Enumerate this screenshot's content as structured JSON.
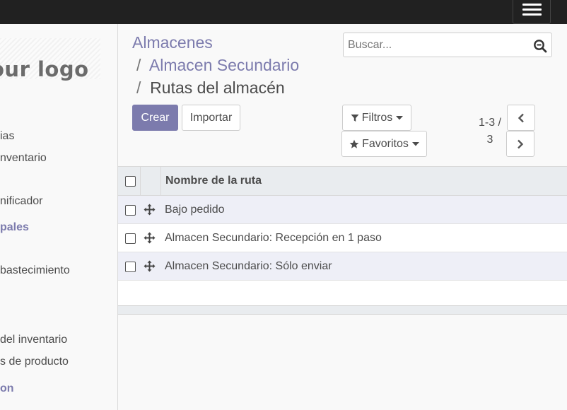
{
  "sidebar": {
    "logo_text": "our logo",
    "items": [
      {
        "label": "ias"
      },
      {
        "label": "nventario"
      },
      {
        "label": "nificador"
      },
      {
        "label": "pales"
      },
      {
        "label": "bastecimiento"
      },
      {
        "label": "del inventario"
      },
      {
        "label": "s de producto"
      },
      {
        "label": "on"
      }
    ]
  },
  "breadcrumb": {
    "items": [
      "Almacenes",
      "Almacen Secundario",
      "Rutas del almacén"
    ],
    "separator": "/"
  },
  "toolbar": {
    "create_label": "Crear",
    "import_label": "Importar"
  },
  "search": {
    "placeholder": "Buscar..."
  },
  "filters": {
    "filters_label": "Filtros",
    "favorites_label": "Favoritos"
  },
  "pager": {
    "value_line1": "1-3 /",
    "value_line2": "3"
  },
  "table": {
    "header": "Nombre de la ruta",
    "rows": [
      {
        "name": "Bajo pedido"
      },
      {
        "name": "Almacen Secundario: Recepción en 1 paso"
      },
      {
        "name": "Almacen Secundario: Sólo enviar"
      }
    ]
  },
  "colors": {
    "primary": "#7c7bad",
    "topbar": "#212121",
    "row_highlight": "#eeeff7"
  },
  "icons": [
    "hamburger-menu-icon",
    "search-icon",
    "filter-icon",
    "star-icon",
    "caret-down-icon",
    "chevron-left-icon",
    "chevron-right-icon",
    "drag-handle-icon"
  ]
}
